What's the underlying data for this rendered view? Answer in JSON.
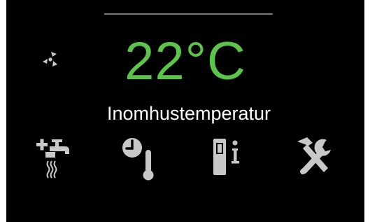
{
  "display": {
    "temperature_value": "22°C",
    "temperature_label": "Inomhustemperatur"
  },
  "icons": {
    "fan": "fan-icon",
    "hot_water": "hot-water-tap-icon",
    "schedule_temperature": "clock-thermometer-icon",
    "info": "device-info-icon",
    "tools": "hammer-wrench-icon"
  },
  "colors": {
    "background": "#000000",
    "temperature_text": "#5cc44b",
    "label_text": "#ffffff",
    "icon": "#c8c8c8"
  }
}
